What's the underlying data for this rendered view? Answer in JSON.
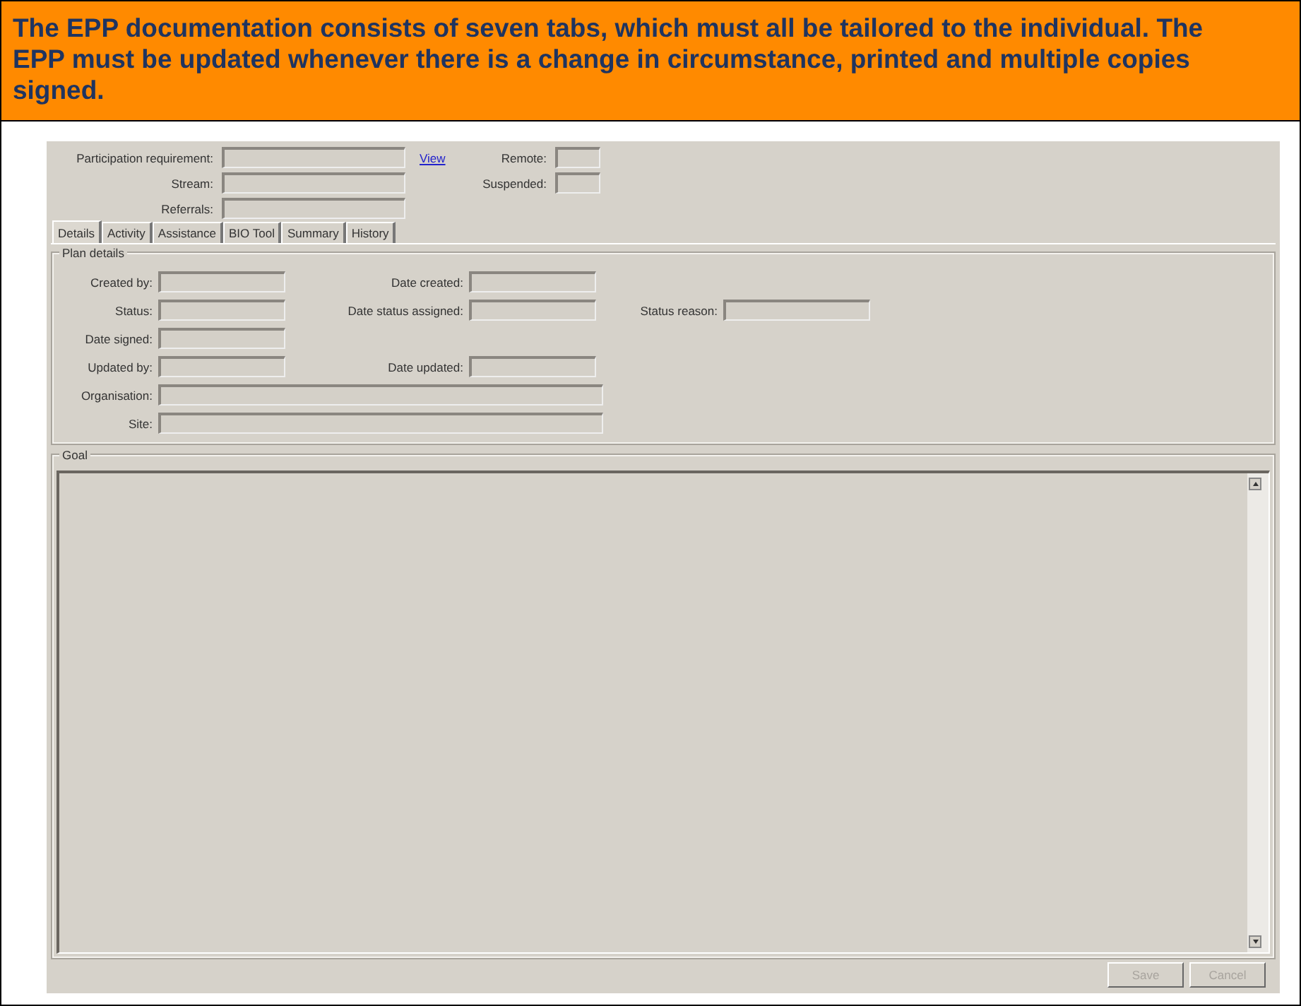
{
  "banner": {
    "text": "The EPP documentation consists of seven tabs, which must all be tailored to the individual. The EPP must be updated whenever there is a change in circumstance, printed and multiple copies signed."
  },
  "header": {
    "rows": [
      {
        "label": "Participation requirement:",
        "link": "View",
        "side_label": "Remote:"
      },
      {
        "label": "Stream:",
        "side_label": "Suspended:"
      },
      {
        "label": "Referrals:"
      }
    ]
  },
  "tabs": [
    {
      "label": "Details",
      "selected": true
    },
    {
      "label": "Activity",
      "selected": false
    },
    {
      "label": "Assistance",
      "selected": false
    },
    {
      "label": "BIO Tool",
      "selected": false
    },
    {
      "label": "Summary",
      "selected": false
    },
    {
      "label": "History",
      "selected": false
    }
  ],
  "plan_details": {
    "title": "Plan details",
    "rows": [
      {
        "kind": "triple",
        "labels": [
          "Created by:",
          "Date created:"
        ]
      },
      {
        "kind": "triple",
        "labels": [
          "Status:",
          "Date status assigned:",
          "Status reason:"
        ]
      },
      {
        "kind": "triple",
        "labels": [
          "Date signed:"
        ]
      },
      {
        "kind": "triple",
        "labels": [
          "Updated by:",
          "Date updated:"
        ]
      },
      {
        "kind": "wide",
        "labels": [
          "Organisation:"
        ]
      },
      {
        "kind": "wide",
        "labels": [
          "Site:"
        ]
      }
    ]
  },
  "goal": {
    "title": "Goal"
  },
  "buttons": [
    {
      "label": "Save",
      "disabled": true
    },
    {
      "label": "Cancel",
      "disabled": true
    }
  ]
}
